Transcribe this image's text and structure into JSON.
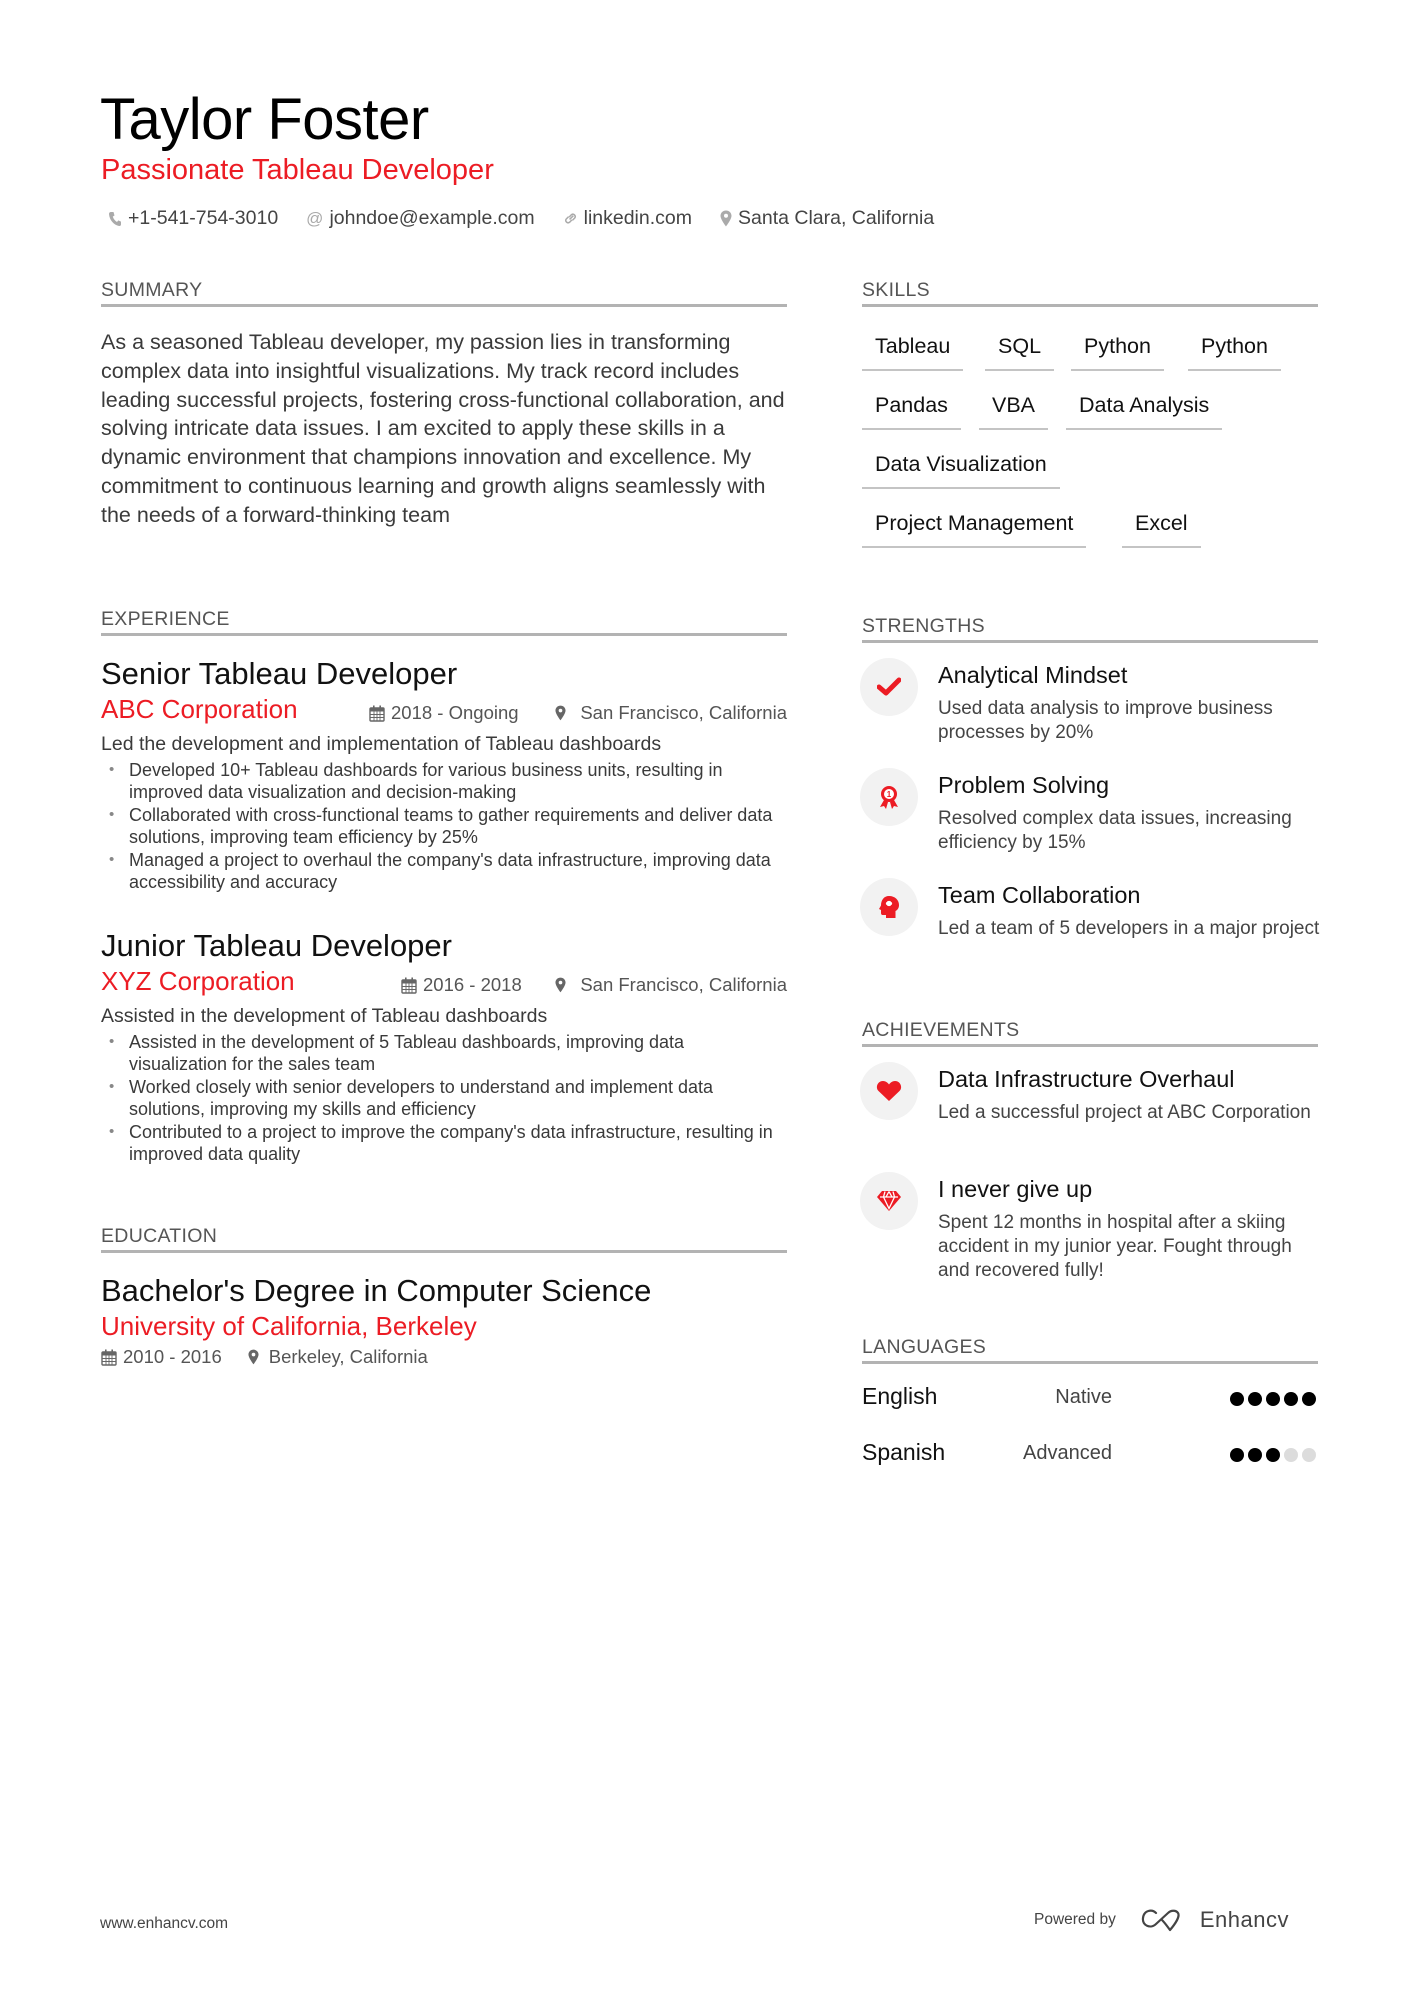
{
  "header": {
    "name": "Taylor Foster",
    "title": "Passionate Tableau Developer",
    "contacts": [
      {
        "icon": "phone-icon",
        "text": "+1-541-754-3010"
      },
      {
        "icon": "at-icon",
        "text": "johndoe@example.com"
      },
      {
        "icon": "link-icon",
        "text": "linkedin.com"
      },
      {
        "icon": "location-pin-icon",
        "text": "Santa Clara, California"
      }
    ]
  },
  "colors": {
    "accent": "#ec1c24",
    "rule": "#b3b3b3",
    "icon_bg": "#f2f2f2"
  },
  "summary": {
    "heading": "SUMMARY",
    "text": "As a seasoned Tableau developer, my passion lies in transforming complex data into insightful visualizations. My track record includes leading successful projects, fostering cross-functional collaboration, and solving intricate data issues. I am excited to apply these skills in a dynamic environment that champions innovation and excellence. My commitment to continuous learning and growth aligns seamlessly with the needs of a forward-thinking team"
  },
  "experience": {
    "heading": "EXPERIENCE",
    "jobs": [
      {
        "title": "Senior Tableau Developer",
        "company": "ABC Corporation",
        "dates": "2018 - Ongoing",
        "location": "San Francisco, California",
        "description": "Led the development and implementation of Tableau dashboards",
        "bullets": [
          "Developed 10+ Tableau dashboards for various business units, resulting in improved data visualization and decision-making",
          "Collaborated with cross-functional teams to gather requirements and deliver data solutions, improving team efficiency by 25%",
          "Managed a project to overhaul the company's data infrastructure, improving data accessibility and accuracy"
        ]
      },
      {
        "title": "Junior Tableau Developer",
        "company": "XYZ Corporation",
        "dates": "2016 - 2018",
        "location": "San Francisco, California",
        "description": "Assisted in the development of Tableau dashboards",
        "bullets": [
          "Assisted in the development of 5 Tableau dashboards, improving data visualization for the sales team",
          "Worked closely with senior developers to understand and implement data solutions, improving my skills and efficiency",
          "Contributed to a project to improve the company's data infrastructure, resulting in improved data quality"
        ]
      }
    ]
  },
  "education": {
    "heading": "EDUCATION",
    "items": [
      {
        "degree": "Bachelor's Degree in Computer Science",
        "school": "University of California, Berkeley",
        "dates": "2010 - 2016",
        "location": "Berkeley, California"
      }
    ]
  },
  "skills": {
    "heading": "SKILLS",
    "items": [
      "Tableau",
      "SQL",
      "Python",
      "Python",
      "Pandas",
      "VBA",
      "Data Analysis",
      "Data Visualization",
      "Project Management",
      "Excel"
    ]
  },
  "strengths": {
    "heading": "STRENGTHS",
    "items": [
      {
        "icon": "checkmark-icon",
        "title": "Analytical Mindset",
        "description": "Used data analysis to improve business processes by 20%"
      },
      {
        "icon": "award-ribbon-icon",
        "title": "Problem Solving",
        "description": "Resolved complex data issues, increasing efficiency by 15%"
      },
      {
        "icon": "head-brain-icon",
        "title": "Team Collaboration",
        "description": "Led a team of 5 developers in a major project"
      }
    ]
  },
  "achievements": {
    "heading": "ACHIEVEMENTS",
    "items": [
      {
        "icon": "heart-icon",
        "title": "Data Infrastructure Overhaul",
        "description": "Led a successful project at ABC Corporation"
      },
      {
        "icon": "diamond-icon",
        "title": "I never give up",
        "description": "Spent 12 months in hospital after a skiing accident in my junior year. Fought through and recovered fully!"
      }
    ]
  },
  "languages": {
    "heading": "LANGUAGES",
    "items": [
      {
        "name": "English",
        "level": "Native",
        "rating": 5,
        "max": 5
      },
      {
        "name": "Spanish",
        "level": "Advanced",
        "rating": 3,
        "max": 5
      }
    ]
  },
  "footer": {
    "website": "www.enhancv.com",
    "powered_by": "Powered by",
    "brand": "Enhancv"
  }
}
